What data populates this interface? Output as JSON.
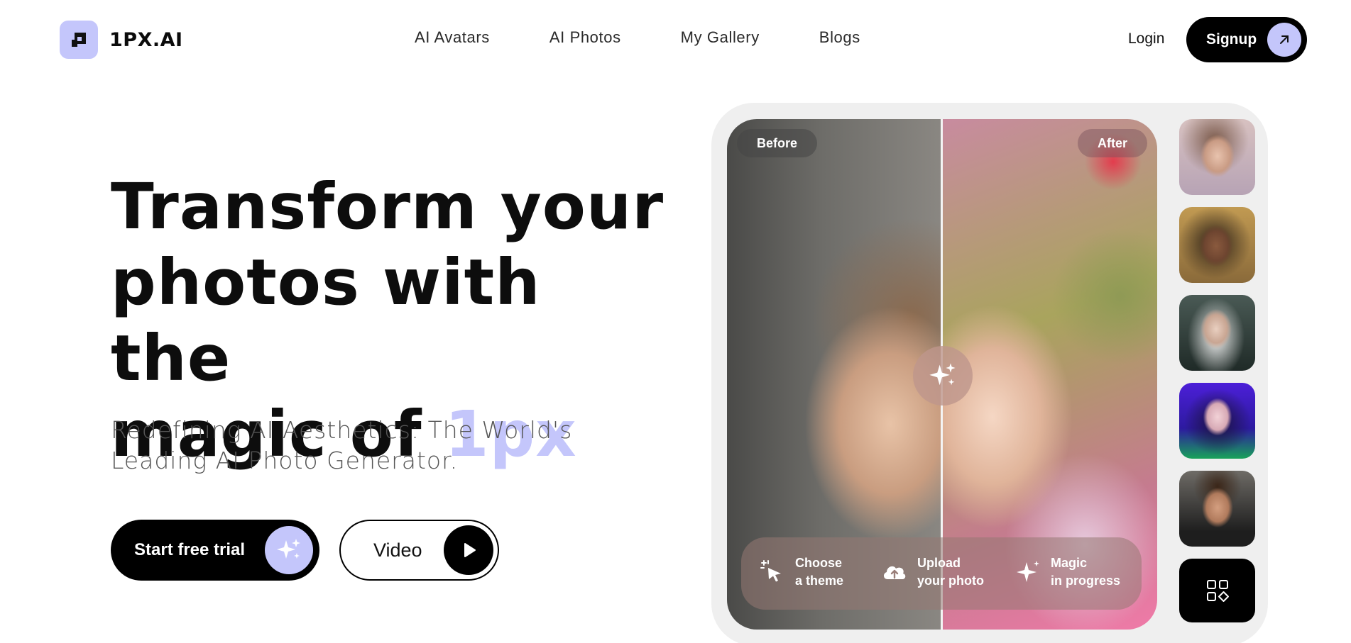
{
  "brand": {
    "name": "1PX.AI",
    "accent": "#c4c6fb"
  },
  "nav": {
    "items": [
      "AI Avatars",
      "AI Photos",
      "My Gallery",
      "Blogs"
    ]
  },
  "auth": {
    "login_label": "Login",
    "signup_label": "Signup"
  },
  "hero": {
    "title_line1": "Transform your",
    "title_line2": "photos with the",
    "title_line3_prefix": "magic of ",
    "title_accent": "1px",
    "subtitle_line1": "Redefining AI Aesthetics: The World's",
    "subtitle_line2": "Leading AI Photo Generator.",
    "primary_cta": "Start free trial",
    "secondary_cta": "Video"
  },
  "showcase": {
    "before_label": "Before",
    "after_label": "After",
    "steps": [
      {
        "line1": "Choose",
        "line2": "a theme",
        "icon": "cursor-sparkle-icon"
      },
      {
        "line1": "Upload",
        "line2": "your photo",
        "icon": "cloud-upload-icon"
      },
      {
        "line1": "Magic",
        "line2": "in progress",
        "icon": "sparkle-icon"
      }
    ],
    "thumbnails": [
      "portrait-1",
      "portrait-2",
      "portrait-3",
      "portrait-4",
      "portrait-5"
    ],
    "more_icon": "grid-icon"
  }
}
